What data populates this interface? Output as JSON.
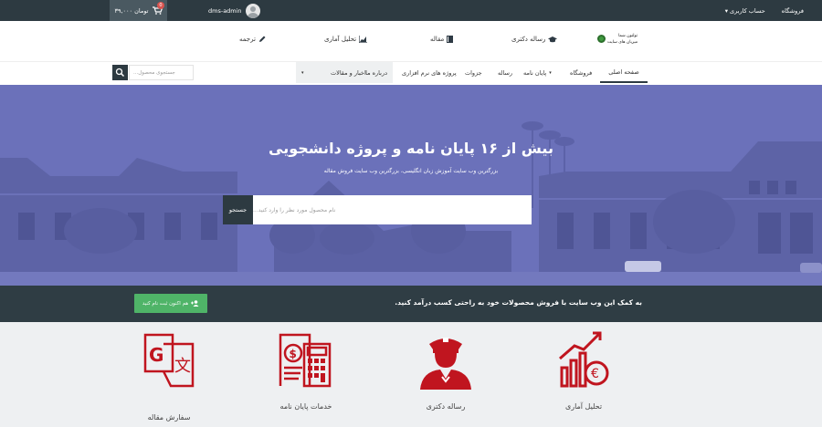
{
  "topbar": {
    "cart_total": "۳۹,۰۰۰ تومان",
    "cart_count": "0",
    "username": "dms-admin",
    "account_label": "حساب کاربری",
    "shop_label": "فروشگاه"
  },
  "header": {
    "logo_line1": "تولتون شما",
    "logo_line2": "میزبان های سایت",
    "links": {
      "doctoral": "رساله دکتری",
      "article": "مقاله",
      "stats": "تحلیل آماری",
      "translation": "ترجمه"
    }
  },
  "nav": {
    "home": "صفحه اصلی",
    "shop": "فروشگاه",
    "thesis": "پایان نامه",
    "dissertation": "رساله",
    "booklets": "جزوات",
    "software_projects": "پروژه های نرم افزاری",
    "news": "اخبار و مقالات",
    "about": "درباره ما",
    "search_placeholder": "جستجوی محصول..."
  },
  "hero": {
    "title": "بیش از ۱۶ پایان نامه و پروژه دانشجویی",
    "subtitle": "بزرگترین وب سایت آموزش زبان انگلیسی، بزرگترین وب سایت فروش مقاله",
    "search_placeholder": "نام محصول مورد نظر را وارد کنید...",
    "search_button": "جستجو"
  },
  "cta": {
    "text": "به کمک این وب سایت با فروش محصولات خود به راحتی کسب درآمد کنید.",
    "button": "هم اکنون ثبت نام کنید"
  },
  "services": [
    {
      "label": "تحلیل آماری",
      "icon": "chart-growth-icon"
    },
    {
      "label": "رساله دکتری",
      "icon": "officer-icon"
    },
    {
      "label": "خدمات پایان نامه",
      "icon": "invoice-calculator-icon"
    },
    {
      "label": "سفارش مقاله",
      "icon": "translate-icon"
    }
  ],
  "colors": {
    "dark": "#2d3a41",
    "accent_red": "#c0151f",
    "green": "#4fb468",
    "hero_tint": "#6a70b8"
  }
}
